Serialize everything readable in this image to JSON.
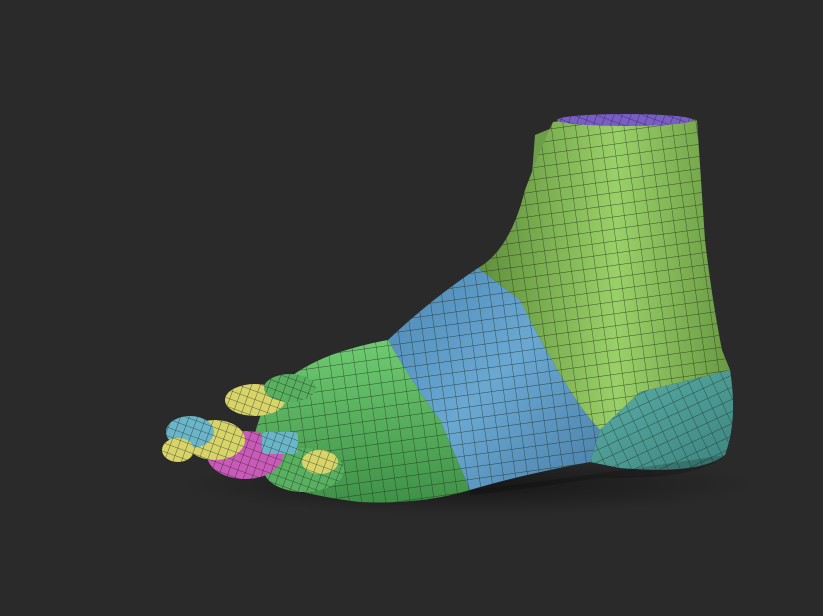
{
  "viewport": {
    "background": "#2a2a2a"
  },
  "model": {
    "subject": "foot",
    "mesh_line_color": "#1c2a16",
    "polygroup_colors": {
      "leg_and_heel_top": "#86c05a",
      "top_cap": "#7a5ec8",
      "instep": "#5d9bc8",
      "forefoot": "#5fbb62",
      "heel_side": "#4f9e98",
      "toe_yellow": "#d7d46a",
      "toe_magenta": "#c85ab8",
      "toe_cyan": "#6ab6c8"
    }
  }
}
